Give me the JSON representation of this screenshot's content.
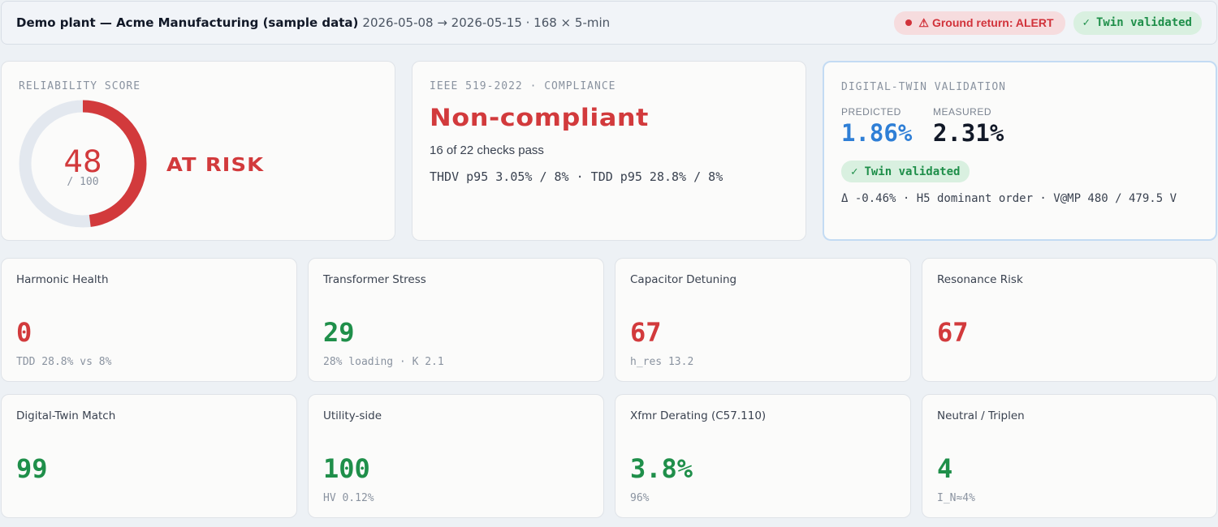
{
  "header": {
    "title": "Demo plant — Acme Manufacturing (sample data)",
    "meta": "2026-05-08 → 2026-05-15 · 168 × 5-min",
    "alert_badge": "Ground return: ALERT",
    "alert_icon": "⚠",
    "validated_badge": "Twin validated",
    "check_icon": "✓"
  },
  "reliability": {
    "caption": "RELIABILITY SCORE",
    "score": 48,
    "score_text": "48",
    "max_text": "/ 100",
    "status": "AT RISK",
    "colors": {
      "track": "#e3e8ef",
      "fill": "#d23a3c"
    }
  },
  "compliance": {
    "caption": "IEEE 519-2022 · COMPLIANCE",
    "status": "Non-compliant",
    "checks": "16 of 22 checks pass",
    "detail": "THDV p95 3.05% / 8% · TDD p95 28.8% / 8%"
  },
  "twin": {
    "caption": "DIGITAL-TWIN VALIDATION",
    "predicted_label": "PREDICTED",
    "predicted_value": "1.86%",
    "measured_label": "MEASURED",
    "measured_value": "2.31%",
    "badge": "Twin validated",
    "detail": "Δ -0.46% · H5 dominant order · V@MP 480 / 479.5 V",
    "colors": {
      "predicted": "#2f7fd6",
      "measured": "#111827"
    }
  },
  "metrics": [
    {
      "label": "Harmonic Health",
      "value": "0",
      "sub": "TDD 28.8% vs 8%",
      "status": "red"
    },
    {
      "label": "Transformer Stress",
      "value": "29",
      "sub": "28% loading · K 2.1",
      "status": "green"
    },
    {
      "label": "Capacitor Detuning",
      "value": "67",
      "sub": "h_res 13.2",
      "status": "red"
    },
    {
      "label": "Resonance Risk",
      "value": "67",
      "sub": "",
      "status": "red"
    },
    {
      "label": "Digital-Twin Match",
      "value": "99",
      "sub": "",
      "status": "green"
    },
    {
      "label": "Utility-side",
      "value": "100",
      "sub": "HV 0.12%",
      "status": "green"
    },
    {
      "label": "Xfmr Derating (C57.110)",
      "value": "3.8%",
      "sub": "96%",
      "status": "green"
    },
    {
      "label": "Neutral / Triplen",
      "value": "4",
      "sub": "I_N≈4%",
      "status": "green"
    }
  ]
}
